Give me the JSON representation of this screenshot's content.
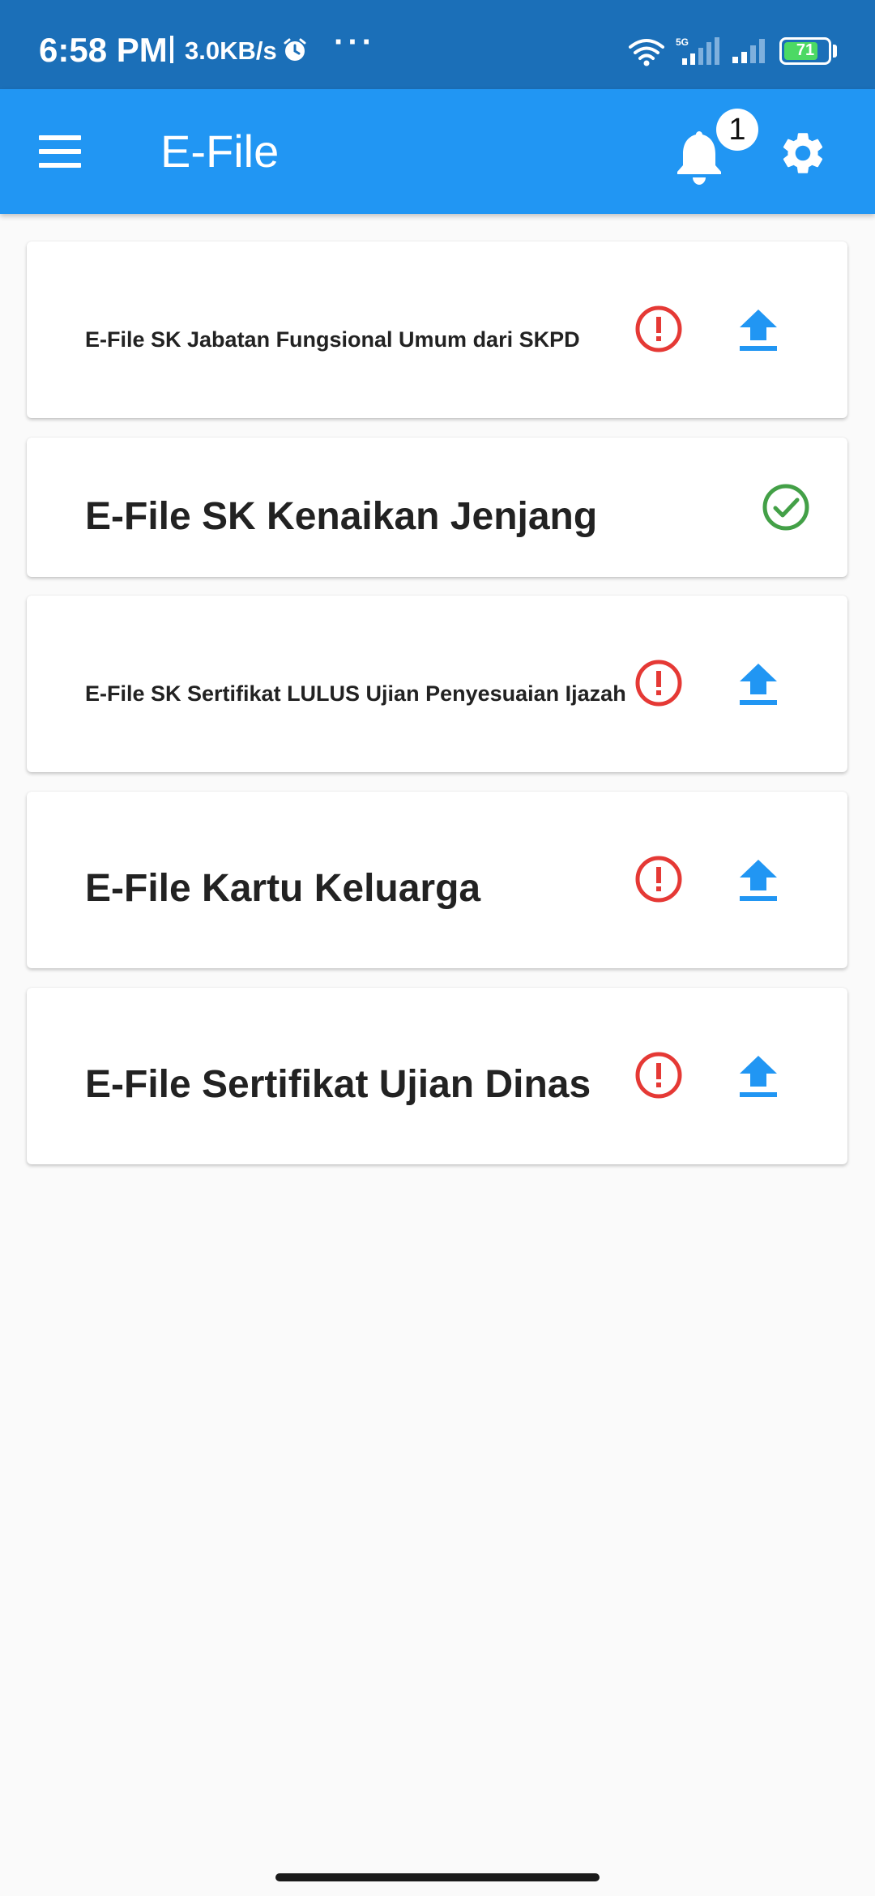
{
  "status_bar": {
    "time": "6:58 PM",
    "speed": "3.0KB/s",
    "more": "···",
    "network_label": "5G",
    "battery": "71",
    "icons": [
      "alarm-icon",
      "wifi-icon",
      "signal-icon",
      "battery-icon"
    ]
  },
  "app_bar": {
    "title": "E-File",
    "notification_count": "1",
    "icons": [
      "menu-icon",
      "bell-icon",
      "gear-icon"
    ]
  },
  "cards": [
    {
      "title": "E-File SK Jabatan Fungsional Umum dari SKPD",
      "status": "missing",
      "upload": true
    },
    {
      "title": "E-File SK Kenaikan Jenjang",
      "status": "uploaded",
      "upload": false
    },
    {
      "title": "E-File SK Sertifikat LULUS Ujian Penyesuaian Ijazah",
      "status": "missing",
      "upload": true
    },
    {
      "title": "E-File Kartu Keluarga",
      "status": "missing",
      "upload": true
    },
    {
      "title": "E-File Sertifikat Ujian Dinas",
      "status": "missing",
      "upload": true
    }
  ],
  "colors": {
    "status_bar": "#1b6fb8",
    "app_bar": "#2196f3",
    "alert": "#e53935",
    "success": "#43a047",
    "upload": "#2196f3",
    "background": "#fafafa"
  }
}
